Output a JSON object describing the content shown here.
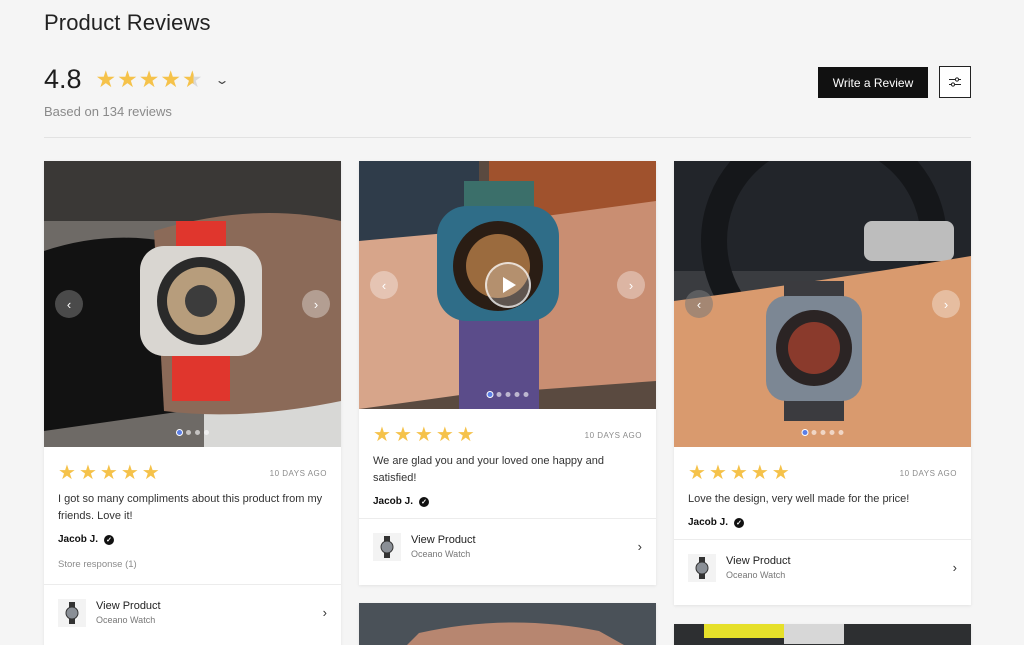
{
  "header": {
    "title": "Product Reviews",
    "average": "4.8",
    "rating": 4.8,
    "based_on": "Based on 134 reviews",
    "write_review_label": "Write a Review"
  },
  "colors": {
    "star": "#f5c24a",
    "button": "#111111",
    "active_dot": "#5b7ee6"
  },
  "icons": {
    "filter": "sliders-icon",
    "verified": "check-badge-icon",
    "chevron": "chevron-right-icon"
  },
  "cards": [
    {
      "stars": 5,
      "date": "10 DAYS AGO",
      "text": "I got so many compliments about this product from my friends. Love it!",
      "author": "Jacob J.",
      "store_response": "Store response (1)",
      "product_title": "View Product",
      "product_sub": "Oceano Watch"
    },
    {
      "stars": 5,
      "date": "10 DAYS AGO",
      "text": "We are glad you and your loved one happy and satisfied!",
      "author": "Jacob J.",
      "product_title": "View Product",
      "product_sub": "Oceano Watch"
    },
    {
      "stars": 5,
      "date": "10 DAYS AGO",
      "text": "Love the design, very well made for the price!",
      "author": "Jacob J.",
      "product_title": "View Product",
      "product_sub": "Oceano Watch"
    }
  ]
}
